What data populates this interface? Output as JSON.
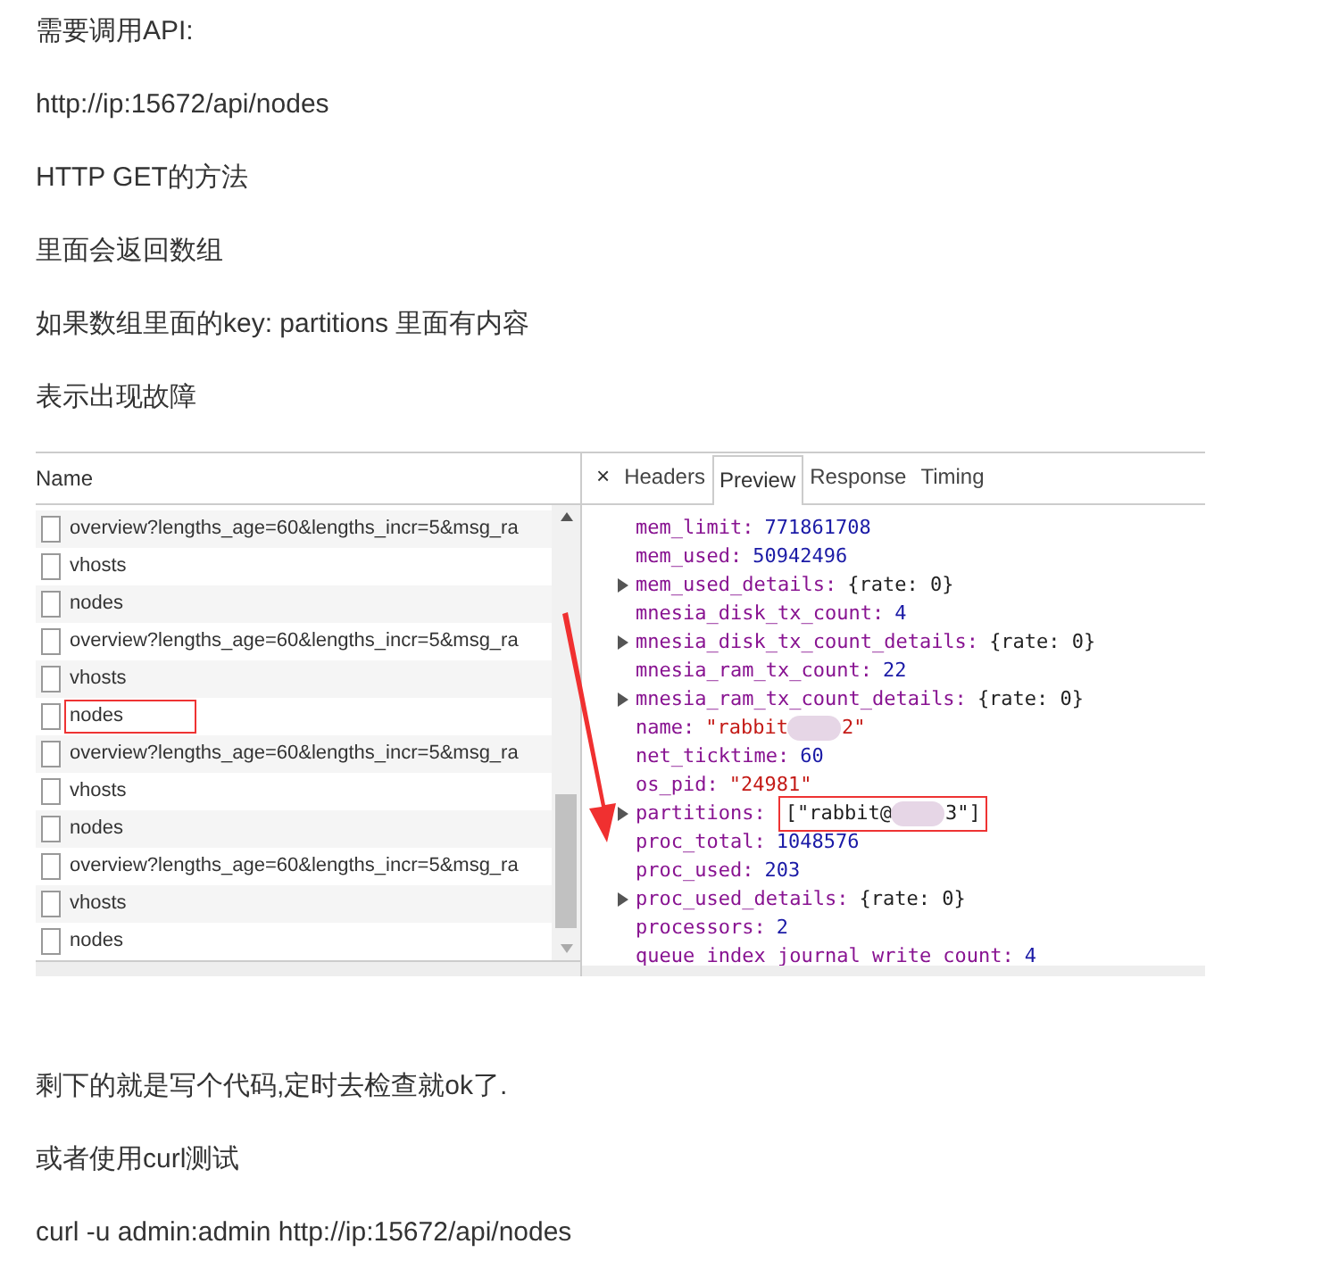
{
  "paragraphs_top": [
    "需要调用API:",
    "http://ip:15672/api/nodes",
    "HTTP GET的方法",
    "里面会返回数组",
    "如果数组里面的key: partitions 里面有内容",
    "表示出现故障"
  ],
  "devtools": {
    "name_column": "Name",
    "requests": [
      {
        "name": "overview?lengths_age=60&lengths_incr=5&msg_ra",
        "highlighted": false
      },
      {
        "name": "vhosts",
        "highlighted": false
      },
      {
        "name": "nodes",
        "highlighted": false
      },
      {
        "name": "overview?lengths_age=60&lengths_incr=5&msg_ra",
        "highlighted": false
      },
      {
        "name": "vhosts",
        "highlighted": false
      },
      {
        "name": "nodes",
        "highlighted": true
      },
      {
        "name": "overview?lengths_age=60&lengths_incr=5&msg_ra",
        "highlighted": false
      },
      {
        "name": "vhosts",
        "highlighted": false
      },
      {
        "name": "nodes",
        "highlighted": false
      },
      {
        "name": "overview?lengths_age=60&lengths_incr=5&msg_ra",
        "highlighted": false
      },
      {
        "name": "vhosts",
        "highlighted": false
      },
      {
        "name": "nodes",
        "highlighted": false
      }
    ],
    "close_glyph": "×",
    "tabs": [
      {
        "label": "Headers",
        "selected": false
      },
      {
        "label": "Preview",
        "selected": true
      },
      {
        "label": "Response",
        "selected": false
      },
      {
        "label": "Timing",
        "selected": false
      }
    ],
    "preview": [
      {
        "key": "mem_limit:",
        "value": "771861708",
        "kind": "number",
        "expandable": false,
        "highlighted": false
      },
      {
        "key": "mem_used:",
        "value": "50942496",
        "kind": "number",
        "expandable": false,
        "highlighted": false
      },
      {
        "key": "mem_used_details:",
        "value": "{rate: 0}",
        "kind": "object",
        "expandable": true,
        "highlighted": false
      },
      {
        "key": "mnesia_disk_tx_count:",
        "value": "4",
        "kind": "number",
        "expandable": false,
        "highlighted": false
      },
      {
        "key": "mnesia_disk_tx_count_details:",
        "value": "{rate: 0}",
        "kind": "object",
        "expandable": true,
        "highlighted": false
      },
      {
        "key": "mnesia_ram_tx_count:",
        "value": "22",
        "kind": "number",
        "expandable": false,
        "highlighted": false
      },
      {
        "key": "mnesia_ram_tx_count_details:",
        "value": "{rate: 0}",
        "kind": "object",
        "expandable": true,
        "highlighted": false
      },
      {
        "key": "name:",
        "value": "\"rabbit",
        "value_end": "2\"",
        "kind": "string",
        "expandable": false,
        "highlighted": false
      },
      {
        "key": "net_ticktime:",
        "value": "60",
        "kind": "number",
        "expandable": false,
        "highlighted": false
      },
      {
        "key": "os_pid:",
        "value": "\"24981\"",
        "kind": "string",
        "expandable": false,
        "highlighted": false
      },
      {
        "key": "partitions:",
        "value": "[\"rabbit@",
        "value_end": "3\"]",
        "kind": "object",
        "expandable": true,
        "highlighted": true
      },
      {
        "key": "proc_total:",
        "value": "1048576",
        "kind": "number",
        "expandable": false,
        "highlighted": false
      },
      {
        "key": "proc_used:",
        "value": "203",
        "kind": "number",
        "expandable": false,
        "highlighted": false
      },
      {
        "key": "proc_used_details:",
        "value": "{rate: 0}",
        "kind": "object",
        "expandable": true,
        "highlighted": false
      },
      {
        "key": "processors:",
        "value": "2",
        "kind": "number",
        "expandable": false,
        "highlighted": false
      },
      {
        "key": "queue_index_journal_write_count:",
        "value": "4",
        "kind": "number",
        "expandable": false,
        "highlighted": false
      }
    ]
  },
  "paragraphs_bottom": [
    "剩下的就是写个代码,定时去检查就ok了.",
    "或者使用curl测试",
    "curl -u admin:admin http://ip:15672/api/nodes"
  ]
}
